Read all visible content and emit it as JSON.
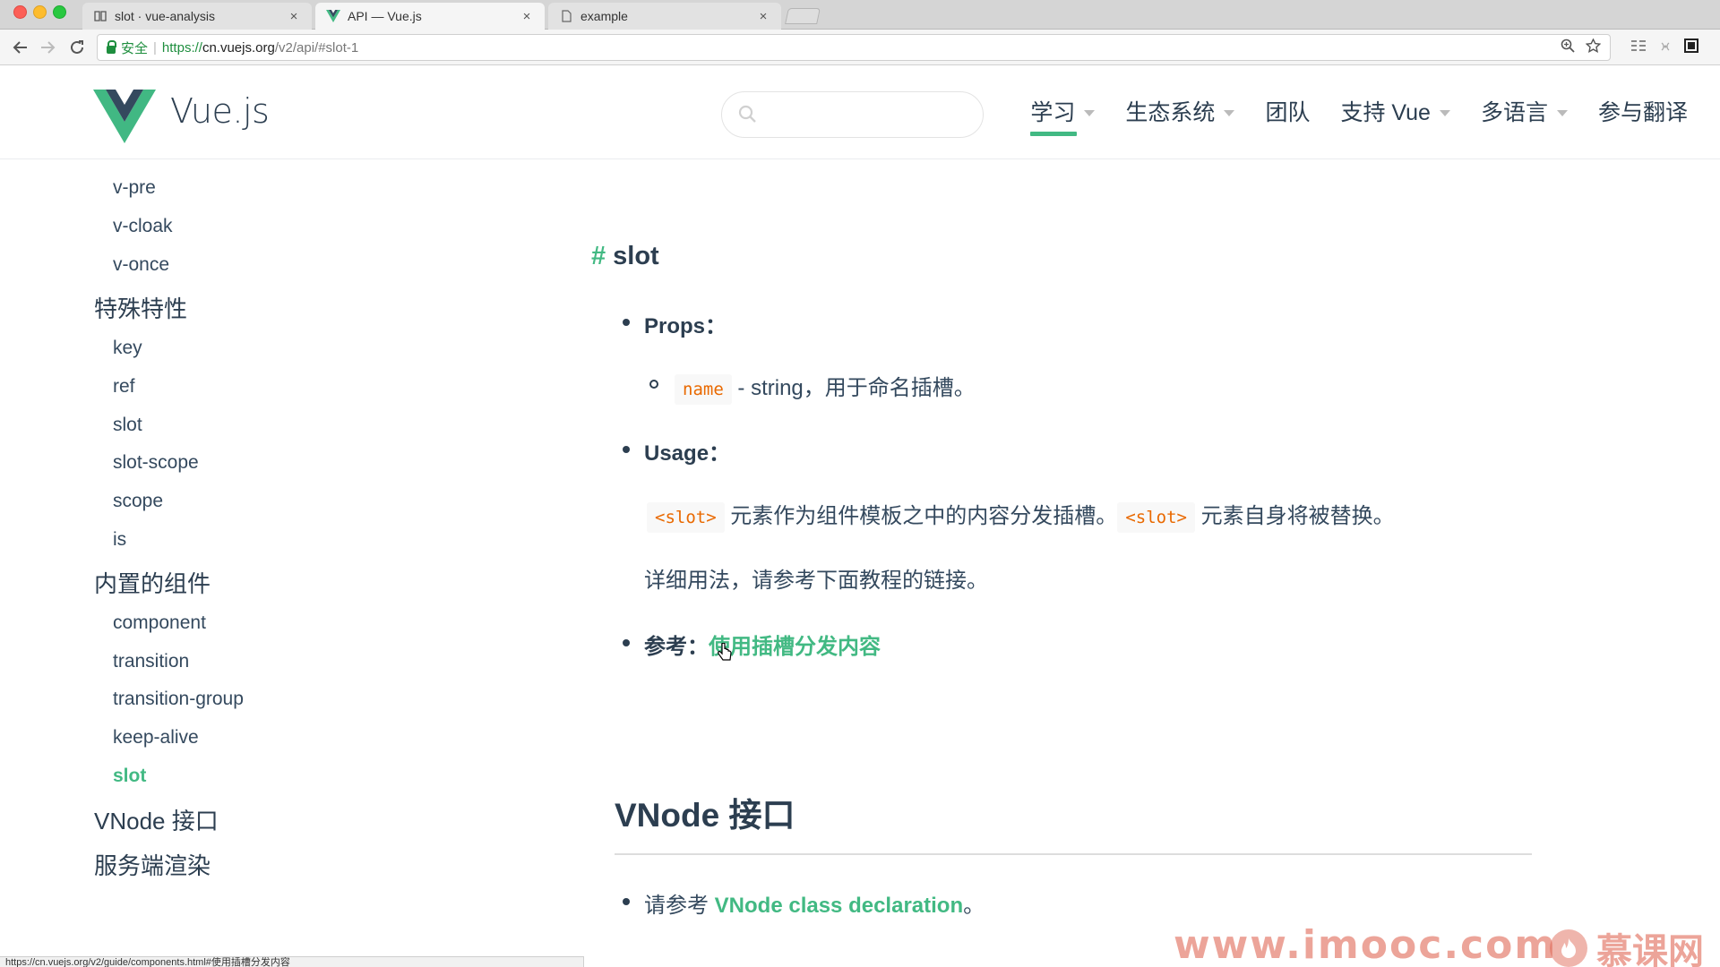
{
  "browser": {
    "tabs": [
      {
        "title": "slot · vue-analysis",
        "icon": "book-icon",
        "active": false
      },
      {
        "title": "API — Vue.js",
        "icon": "vue-icon",
        "active": true
      },
      {
        "title": "example",
        "icon": "document-icon",
        "active": false
      }
    ],
    "close_glyph": "×",
    "secure_label": "安全",
    "url_proto": "https://",
    "url_host": "cn.vuejs.org",
    "url_path": "/v2/api/#slot-1",
    "status_url": "https://cn.vuejs.org/v2/guide/components.html#使用插槽分发内容"
  },
  "site": {
    "brand": "Vue.js",
    "search_placeholder": "",
    "nav": [
      {
        "label": "学习",
        "caret": true,
        "current": true
      },
      {
        "label": "生态系统",
        "caret": true,
        "current": false
      },
      {
        "label": "团队",
        "caret": false,
        "current": false
      },
      {
        "label": "支持 Vue",
        "caret": true,
        "current": false
      },
      {
        "label": "多语言",
        "caret": true,
        "current": false
      },
      {
        "label": "参与翻译",
        "caret": false,
        "current": false
      }
    ],
    "accent": "#42b983"
  },
  "sidebar": {
    "items": [
      {
        "label": "v-pre",
        "kind": "item"
      },
      {
        "label": "v-cloak",
        "kind": "item"
      },
      {
        "label": "v-once",
        "kind": "item"
      },
      {
        "label": "特殊特性",
        "kind": "head"
      },
      {
        "label": "key",
        "kind": "item"
      },
      {
        "label": "ref",
        "kind": "item"
      },
      {
        "label": "slot",
        "kind": "item"
      },
      {
        "label": "slot-scope",
        "kind": "item"
      },
      {
        "label": "scope",
        "kind": "item"
      },
      {
        "label": "is",
        "kind": "item"
      },
      {
        "label": "内置的组件",
        "kind": "head"
      },
      {
        "label": "component",
        "kind": "item"
      },
      {
        "label": "transition",
        "kind": "item"
      },
      {
        "label": "transition-group",
        "kind": "item"
      },
      {
        "label": "keep-alive",
        "kind": "item"
      },
      {
        "label": "slot",
        "kind": "item",
        "active": true
      },
      {
        "label": "VNode 接口",
        "kind": "head"
      },
      {
        "label": "服务端渲染",
        "kind": "head"
      }
    ]
  },
  "content": {
    "hash": "#",
    "heading": "slot",
    "props_label": "Props：",
    "prop_name": "name",
    "prop_desc": " - string，用于命名插槽。",
    "usage_label": "Usage：",
    "usage_code1": "<slot>",
    "usage_text1": " 元素作为组件模板之中的内容分发插槽。",
    "usage_code2": "<slot>",
    "usage_text2": " 元素自身将被替换。",
    "usage_more": "详细用法，请参考下面教程的链接。",
    "see_label": "参考：",
    "see_link": "使用插槽分发内容",
    "vnode_heading": "VNode 接口",
    "vnode_prefix": "请参考 ",
    "vnode_link": "VNode class declaration",
    "vnode_suffix": "。"
  },
  "watermark": {
    "site": "www.imooc.com",
    "brand": "慕课网"
  }
}
